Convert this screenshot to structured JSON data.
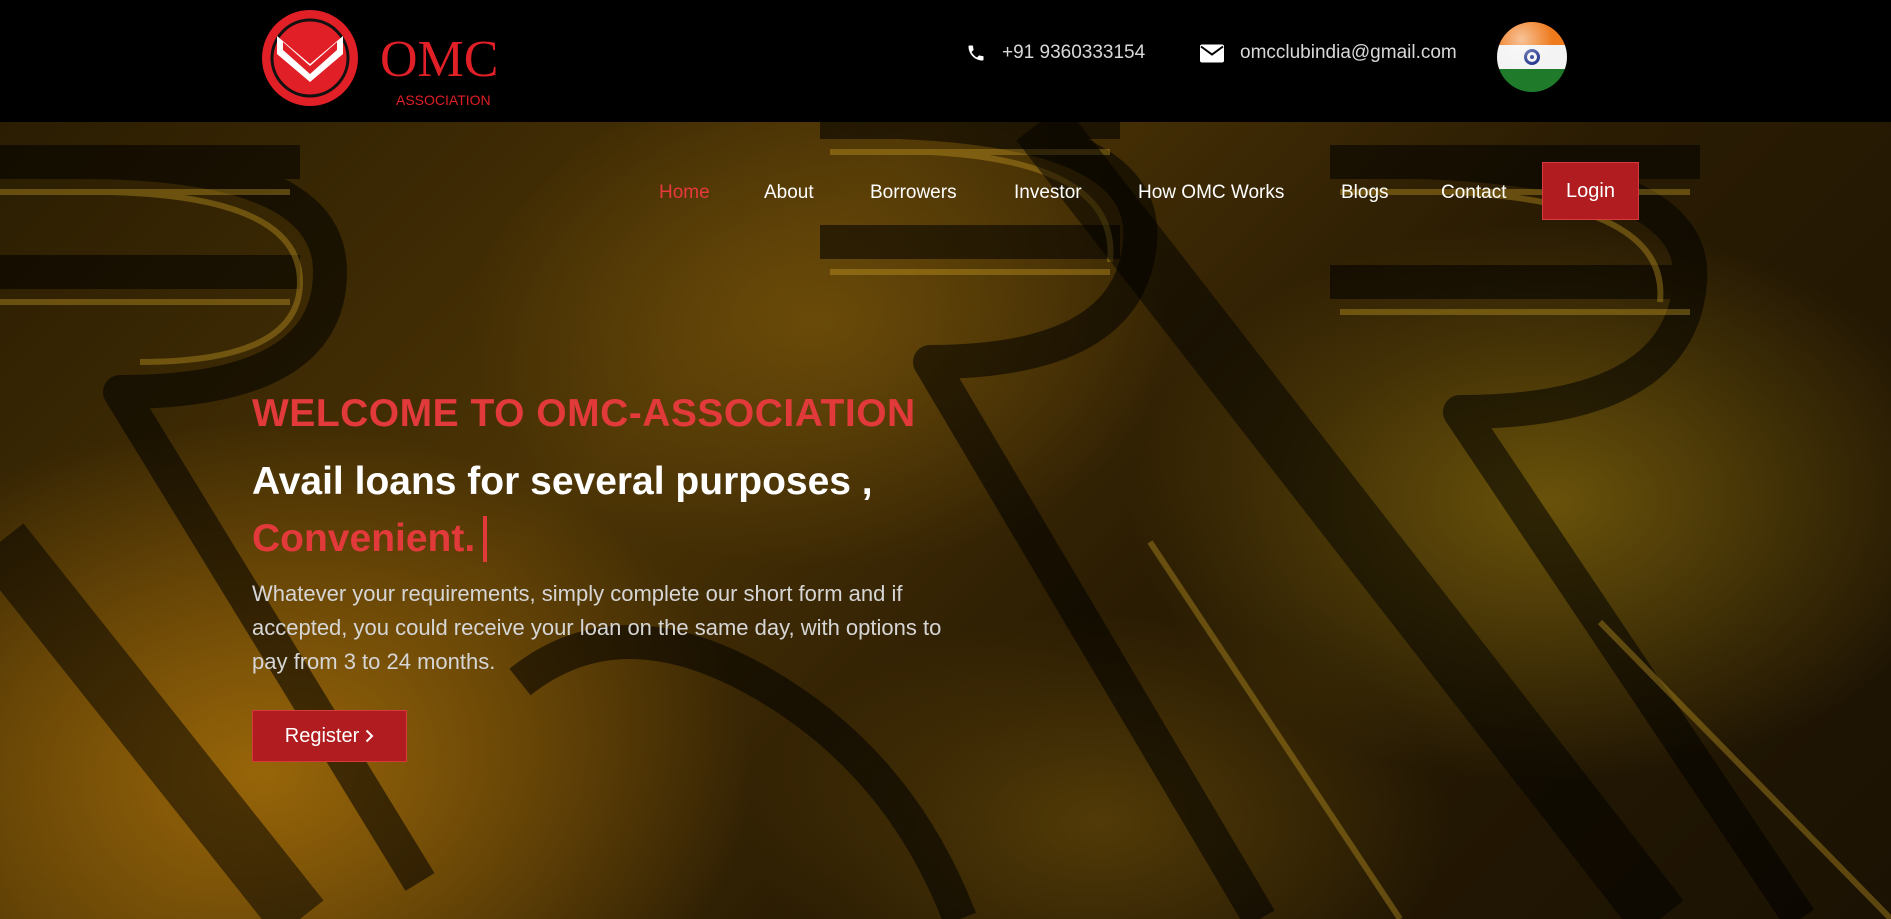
{
  "topbar": {
    "logo": {
      "wordmark": "OMC",
      "subtitle": "ASSOCIATION"
    },
    "phone": "+91 9360333154",
    "email": "omcclubindia@gmail.com"
  },
  "nav": {
    "items": [
      {
        "label": "Home",
        "active": true
      },
      {
        "label": "About",
        "active": false
      },
      {
        "label": "Borrowers",
        "active": false
      },
      {
        "label": "Investor",
        "active": false
      },
      {
        "label": "How OMC Works",
        "active": false
      },
      {
        "label": "Blogs",
        "active": false
      },
      {
        "label": "Contact",
        "active": false
      }
    ],
    "login_label": "Login"
  },
  "hero": {
    "welcome": "WELCOME TO OMC-ASSOCIATION",
    "headline": "Avail loans for several purposes ,",
    "typed_word": "Convenient.",
    "description": "Whatever your requirements, simply complete our short form and if accepted, you could receive your loan on the same day, with options to pay from 3 to 24 months.",
    "register_label": "Register"
  },
  "colors": {
    "accent_red": "#e2393b",
    "button_red": "#b01c1f",
    "background": "#000000",
    "hero_gold": "#4c3405"
  }
}
